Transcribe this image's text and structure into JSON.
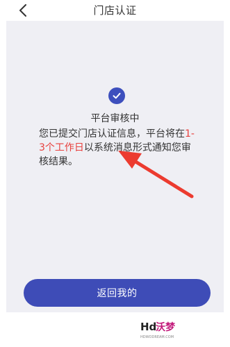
{
  "nav": {
    "title": "门店认证",
    "back_icon": "chevron-left-icon"
  },
  "status": {
    "icon": "check-circle-icon",
    "title": "平台审核中",
    "message_part1": "您已提交门店认证信息，平台将在",
    "message_highlight_a": "1-3",
    "message_highlight_b": "个工作日",
    "message_part2": "以系统消息形式通知您审核结果。"
  },
  "actions": {
    "return_label": "返回我的"
  },
  "annotation": {
    "arrow_icon": "red-arrow-icon"
  },
  "watermark": {
    "logo_text": "Hd沃梦",
    "subtext": "HDWODREAM.COM"
  },
  "colors": {
    "accent": "#3e4cb7",
    "highlight": "#e8403d",
    "panel_bg": "#efeff4"
  }
}
